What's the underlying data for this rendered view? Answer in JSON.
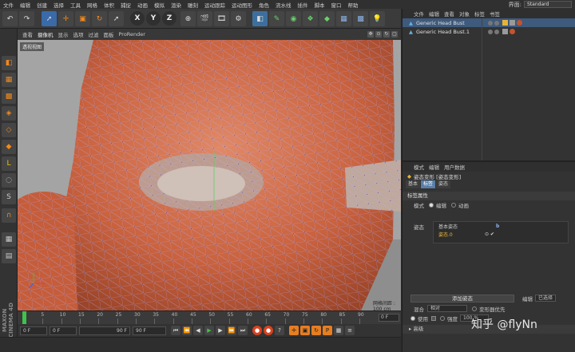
{
  "menubar": {
    "items": [
      "文件",
      "编辑",
      "创建",
      "选择",
      "工具",
      "网格",
      "体积",
      "捕捉",
      "动画",
      "模拟",
      "渲染",
      "雕刻",
      "运动跟踪",
      "运动图形",
      "角色",
      "流水线",
      "插件",
      "脚本",
      "窗口",
      "帮助"
    ],
    "layout_label": "界面:",
    "layout_value": "Standard"
  },
  "toolbar": {
    "axis_x": "X",
    "axis_y": "Y",
    "axis_z": "Z"
  },
  "viewport": {
    "menu": [
      "查看",
      "摄像机",
      "显示",
      "选项",
      "过滤",
      "面板",
      "ProRender"
    ],
    "camera_label": "透视视图",
    "grid_spacing": "网格间距 : 100 cm"
  },
  "timeline": {
    "ticks": [
      "0",
      "5",
      "10",
      "15",
      "20",
      "25",
      "30",
      "35",
      "40",
      "45",
      "50",
      "55",
      "60",
      "65",
      "70",
      "75",
      "80",
      "85",
      "90"
    ],
    "current_frame": "0 F"
  },
  "transport": {
    "start": "0 F",
    "current": "0 F",
    "end_a": "90 F",
    "end_b": "90 F"
  },
  "object_manager": {
    "menu": [
      "文件",
      "编辑",
      "查看",
      "对象",
      "标签",
      "书签"
    ],
    "objects": [
      {
        "name": "Generic Head Bust",
        "selected": true
      },
      {
        "name": "Generic Head Bust.1",
        "selected": false
      }
    ]
  },
  "attribute_manager": {
    "menu": [
      "模式",
      "编辑",
      "用户数据"
    ],
    "title": "姿态变形 [姿态变形]",
    "tabs": [
      "基本",
      "标签",
      "姿态"
    ],
    "section": "标签属性",
    "mode_label": "模式",
    "mode_edit": "编辑",
    "mode_animate": "动画",
    "pose_label": "姿态",
    "poses": [
      "基本姿态",
      "姿态.0"
    ],
    "add_pose": "添加姿态",
    "blend_label": "混合",
    "blend_value": "相对",
    "deform_priority": "变形器优先",
    "edit_label": "编辑",
    "edit_value": "已选择",
    "use_label": "使用",
    "strength_label": "强度",
    "strength_value": "100 %",
    "advanced": "高级"
  },
  "watermark": "知乎 @flyNn",
  "colors": {
    "mesh": "#c9623f",
    "selection": "#3e5a7c",
    "accent_orange": "#f08a1c"
  }
}
